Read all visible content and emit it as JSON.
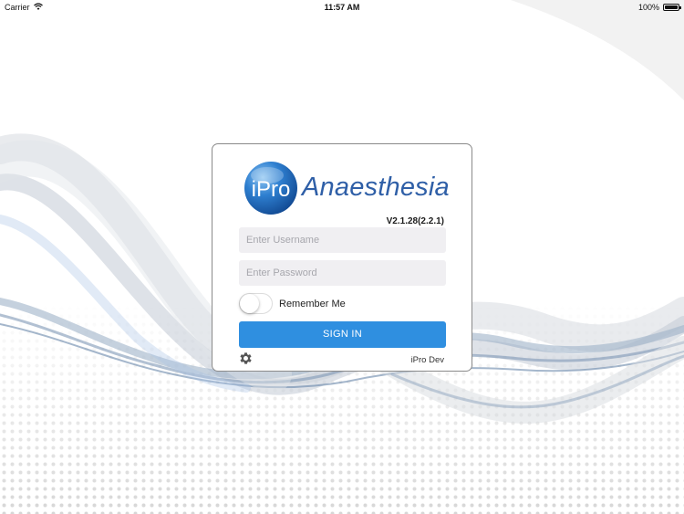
{
  "status_bar": {
    "carrier": "Carrier",
    "time": "11:57 AM",
    "battery": "100%"
  },
  "login": {
    "logo_mark": "iPro",
    "logo_text": "Anaesthesia",
    "version": "V2.1.28(2.2.1)",
    "username_placeholder": "Enter Username",
    "password_placeholder": "Enter Password",
    "remember_label": "Remember Me",
    "remember_on": false,
    "signin_label": "SIGN IN",
    "settings_icon": "gear-icon",
    "environment": "iPro Dev"
  },
  "colors": {
    "accent": "#2f8fe0",
    "logo_blue": "#2f5fa7"
  }
}
